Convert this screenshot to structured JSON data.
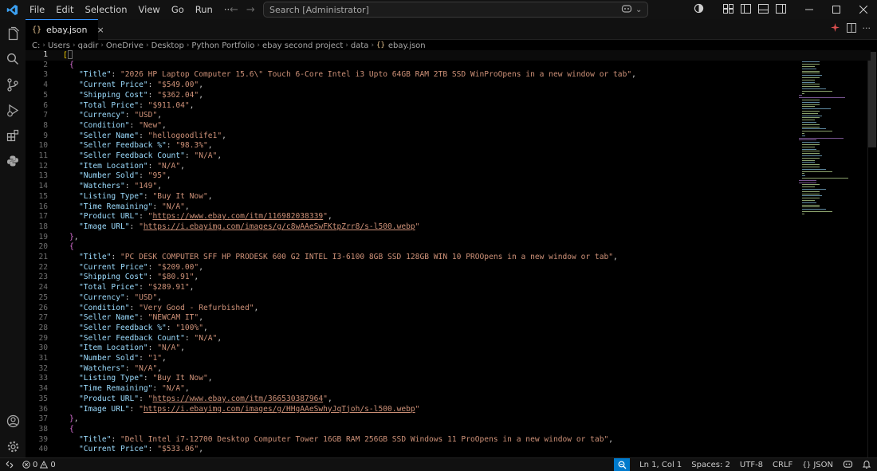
{
  "menu": [
    "File",
    "Edit",
    "Selection",
    "View",
    "Go",
    "Run",
    "···"
  ],
  "search": {
    "placeholder": "Search [Administrator]"
  },
  "tab": {
    "filename": "ebay.json"
  },
  "breadcrumb": [
    "C:",
    "Users",
    "qadir",
    "OneDrive",
    "Desktop",
    "Python Portfolio",
    "ebay second project",
    "data",
    "ebay.json"
  ],
  "records": [
    {
      "Title": "2026 HP Laptop Computer 15.6\\\" Touch 6-Core Intel i3 Upto 64GB RAM 2TB SSD WinProOpens in a new window or tab",
      "Current Price": "$549.00",
      "Shipping Cost": "$362.04",
      "Total Price": "$911.04",
      "Currency": "USD",
      "Condition": "New",
      "Seller Name": "hellogoodlife1",
      "Seller Feedback %": "98.3%",
      "Seller Feedback Count": "N/A",
      "Item Location": "N/A",
      "Number Sold": "95",
      "Watchers": "149",
      "Listing Type": "Buy It Now",
      "Time Remaining": "N/A",
      "Product URL": "https://www.ebay.com/itm/116982038339",
      "Image URL": "https://i.ebayimg.com/images/g/c8wAAeSwFKtpZrr8/s-l500.webp"
    },
    {
      "Title": "PC DESK COMPUTER SFF HP PRODESK 600 G2 INTEL I3-6100 8GB SSD 128GB WIN 10 PROOpens in a new window or tab",
      "Current Price": "$209.00",
      "Shipping Cost": "$80.91",
      "Total Price": "$289.91",
      "Currency": "USD",
      "Condition": "Very Good - Refurbished",
      "Seller Name": "NEWCAM IT",
      "Seller Feedback %": "100%",
      "Seller Feedback Count": "N/A",
      "Item Location": "N/A",
      "Number Sold": "1",
      "Watchers": "N/A",
      "Listing Type": "Buy It Now",
      "Time Remaining": "N/A",
      "Product URL": "https://www.ebay.com/itm/366530387964",
      "Image URL": "https://i.ebayimg.com/images/g/HHgAAeSwhyJqTjoh/s-l500.webp"
    },
    {
      "Title": "Dell Intel i7-12700 Desktop Computer Tower 16GB RAM 256GB SSD Windows 11 ProOpens in a new window or tab",
      "Current Price": "$533.06"
    }
  ],
  "status": {
    "problems_errors": "0",
    "problems_warnings": "0",
    "cursor": "Ln 1, Col 1",
    "spaces": "Spaces: 2",
    "encoding": "UTF-8",
    "eol": "CRLF",
    "language": "JSON"
  },
  "colors": {
    "accent": "#007acc",
    "key": "#9cdcfe",
    "string": "#ce9178",
    "bracket_outer": "#ffd700",
    "bracket_inner": "#da70d6"
  }
}
